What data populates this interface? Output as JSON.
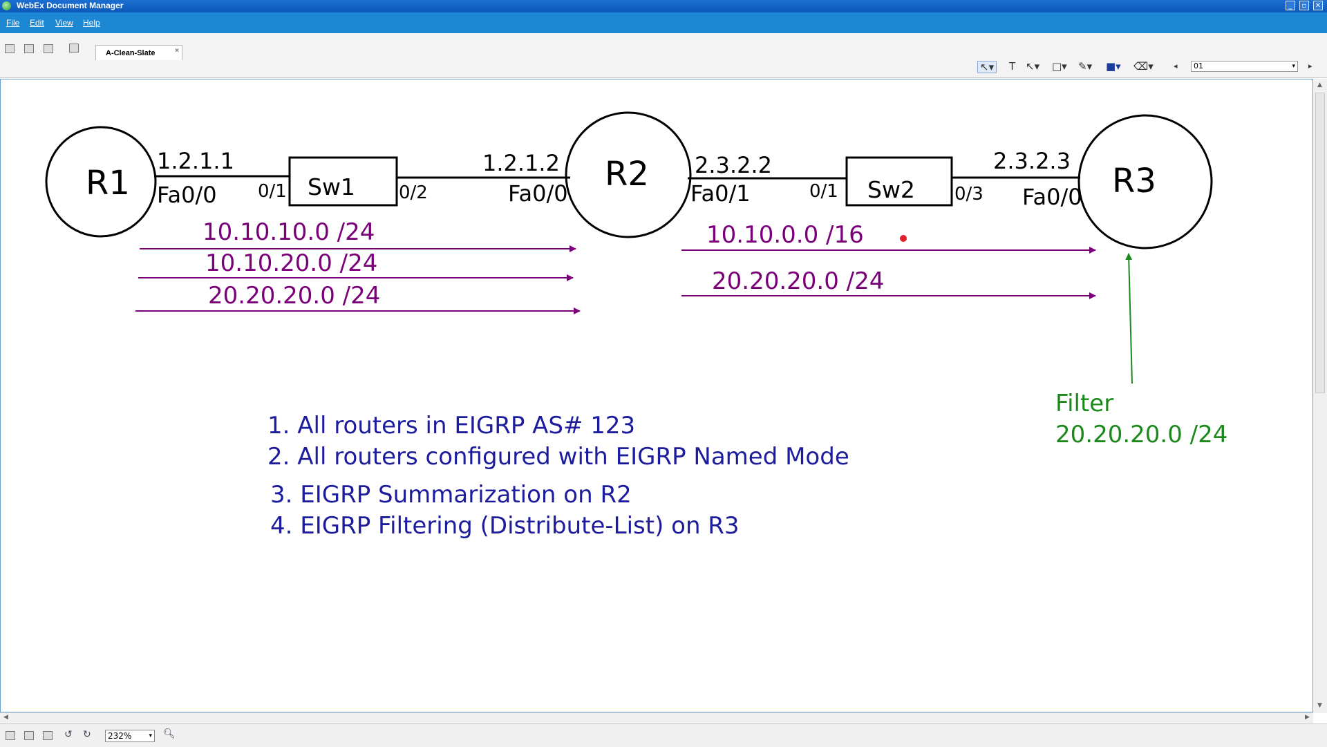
{
  "window": {
    "title": "WebEx Document Manager"
  },
  "menu": [
    "File",
    "Edit",
    "View",
    "Help"
  ],
  "tabs": [
    {
      "label": "A-Clean-Slate",
      "close": "×"
    }
  ],
  "toolbar": {
    "page_value": "01"
  },
  "status": {
    "zoom": "232%"
  },
  "diagram": {
    "routers": [
      "R1",
      "R2",
      "R3"
    ],
    "switches": [
      "Sw1",
      "Sw2"
    ],
    "ip": {
      "r1_sw1": "1.2.1.1",
      "r2_sw1": "1.2.1.2",
      "r2_sw2": "2.3.2.2",
      "r3_sw2": "2.3.2.3"
    },
    "ports": {
      "r1": "Fa0/0",
      "sw1_left": "0/1",
      "sw1_right": "0/2",
      "r2_left": "Fa0/0",
      "r2_right": "Fa0/1",
      "sw2_left": "0/1",
      "sw2_right": "0/3",
      "r3": "Fa0/0"
    },
    "routes_r1_r2": [
      "10.10.10.0 /24",
      "10.10.20.0 /24",
      "20.20.20.0 /24"
    ],
    "routes_r2_r3": [
      "10.10.0.0 /16",
      "20.20.20.0 /24"
    ],
    "filter": {
      "label": "Filter",
      "prefix": "20.20.20.0 /24"
    },
    "notes": [
      "1. All routers in EIGRP AS# 123",
      "2. All routers configured with EIGRP Named Mode",
      "3. EIGRP Summarization on R2",
      "4. EIGRP Filtering (Distribute-List) on R3"
    ],
    "colors": {
      "routes": "#7a007a",
      "notes": "#1c1c9c",
      "filter": "#1b8a1b",
      "pointer": "#e0202a"
    }
  }
}
